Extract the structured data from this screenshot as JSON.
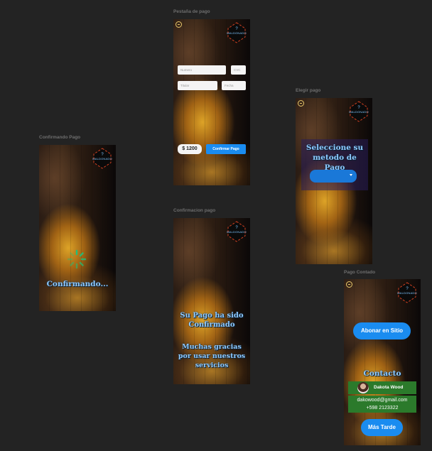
{
  "frames": {
    "pestana": {
      "label": "Pestaña de pago",
      "logo_text": "MALDONADO",
      "number_placeholder": "Numero",
      "cvc_placeholder": "CVC",
      "holder_placeholder": "Titular",
      "date_placeholder": "Fecha",
      "amount": "$ 1200",
      "confirm_label": "Confirmar Pago"
    },
    "confirmando": {
      "label": "Confirmando Pago",
      "logo_text": "MALDONADO",
      "status_text": "Confirmando..."
    },
    "confirmacion": {
      "label": "Confirmacion pago",
      "logo_text": "MALDONADO",
      "line1": "Su Pago ha sido Confirmado",
      "line2": "Muchas gracias por usar nuestros servicios"
    },
    "elegir": {
      "label": "Elegir pago",
      "logo_text": "MALDONADO",
      "heading": "Seleccione su metodo de Pago",
      "select_value": ""
    },
    "contado": {
      "label": "Pago Contado",
      "logo_text": "MALDONADO",
      "pay_button": "Abonar en Sitio",
      "contact_heading": "Contacto",
      "contact_name": "Dakota Wood",
      "contact_email": "dakowood@gmail.com",
      "contact_phone": "+598 2123322",
      "later_button": "Más Tarde"
    }
  },
  "colors": {
    "canvas": "#232323",
    "accent_blue": "#1a8cf0",
    "heading_blue": "#8ec9ff",
    "contact_green": "#2b7a2b",
    "spinner_green": "#1fbf7a"
  }
}
